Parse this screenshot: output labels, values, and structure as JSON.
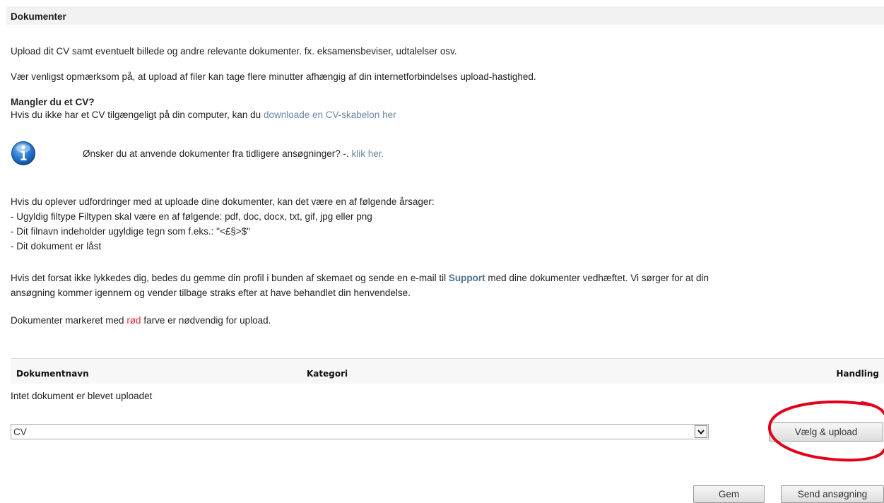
{
  "header": {
    "title": "Dokumenter"
  },
  "intro": {
    "line1": "Upload dit CV samt eventuelt billede og andre relevante dokumenter. fx. eksamensbeviser, udtalelser osv.",
    "line2": "Vær venligst opmærksom på, at upload af filer kan tage flere minutter afhængig af din internetforbindelses upload-hastighed."
  },
  "missing_cv": {
    "heading": "Mangler du et CV?",
    "text": "Hvis du ikke har et CV tilgængeligt på din computer, kan du ",
    "link": "downloade en CV-skabelon her"
  },
  "info": {
    "icon": "info-icon",
    "text": "Ønsker du at anvende dokumenter fra tidligere ansøgninger? -. ",
    "link": "klik her."
  },
  "troubleshoot": {
    "intro": "Hvis du oplever udfordringer med at uploade dine dokumenter, kan det være en af følgende årsager:",
    "items": [
      "- Ugyldig filtype Filtypen skal være en af følgende: pdf, doc, docx, txt, gif, jpg eller png",
      "- Dit filnavn indeholder ugyldige tegn som f.eks.: \"<£§>$\"",
      "- Dit dokument er låst"
    ]
  },
  "support": {
    "before": "Hvis det forsat ikke lykkedes dig, bedes du gemme din profil i bunden af skemaet og sende en e-mail til ",
    "link": "Support",
    "after": " med dine dokumenter vedhæftet. Vi sørger for at din",
    "line2": "ansøgning kommer igennem og vender tilbage straks efter at have behandlet din henvendelse."
  },
  "required_note": {
    "before": "Dokumenter markeret med ",
    "red_word": "rød",
    "after": " farve er nødvendig for upload."
  },
  "table": {
    "columns": [
      "Dokumentnavn",
      "Kategori",
      "Handling"
    ],
    "empty_text": "Intet dokument er blevet uploadet"
  },
  "upload": {
    "selected_category": "CV",
    "button_label": "Vælg & upload"
  },
  "footer": {
    "save_label": "Gem",
    "send_label": "Send ansøgning"
  },
  "colors": {
    "link": "#6b86a3",
    "required": "#e0262e",
    "highlight": "#e3001b"
  }
}
